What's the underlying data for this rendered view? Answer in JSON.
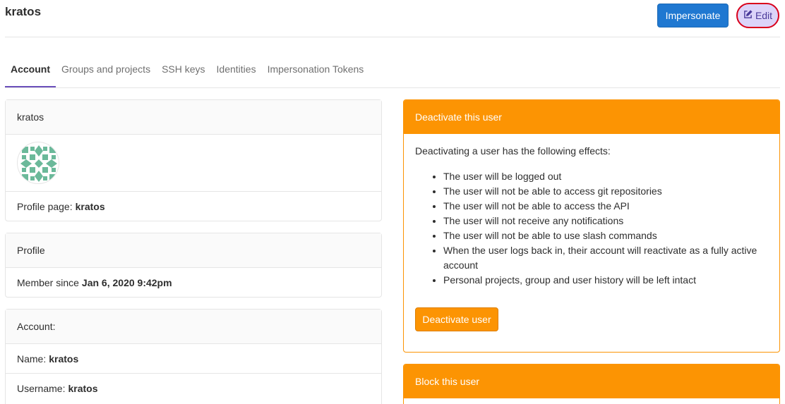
{
  "header": {
    "username": "kratos",
    "impersonate_label": "Impersonate",
    "edit_label": "Edit",
    "edit_icon": "pencil-square-icon"
  },
  "tabs": [
    {
      "label": "Account",
      "active": true
    },
    {
      "label": "Groups and projects",
      "active": false
    },
    {
      "label": "SSH keys",
      "active": false
    },
    {
      "label": "Identities",
      "active": false
    },
    {
      "label": "Impersonation Tokens",
      "active": false
    }
  ],
  "user_card": {
    "title": "kratos",
    "profile_page_label": "Profile page:",
    "profile_page_value": "kratos"
  },
  "profile_card": {
    "title": "Profile",
    "member_since_label": "Member since",
    "member_since_value": "Jan 6, 2020 9:42pm"
  },
  "account_card": {
    "title": "Account:",
    "name_label": "Name:",
    "name_value": "kratos",
    "username_label": "Username:",
    "username_value": "kratos"
  },
  "deactivate_card": {
    "title": "Deactivate this user",
    "intro": "Deactivating a user has the following effects:",
    "effects": [
      "The user will be logged out",
      "The user will not be able to access git repositories",
      "The user will not be able to access the API",
      "The user will not receive any notifications",
      "The user will not be able to use slash commands",
      "When the user logs back in, their account will reactivate as a fully active account",
      "Personal projects, group and user history will be left intact"
    ],
    "button_label": "Deactivate user"
  },
  "block_card": {
    "title": "Block this user"
  },
  "colors": {
    "primary": "#1f78d1",
    "warning": "#fc9403",
    "tab_active_border": "#6b4fbb",
    "avatar_identicon": "#6bb99a"
  }
}
